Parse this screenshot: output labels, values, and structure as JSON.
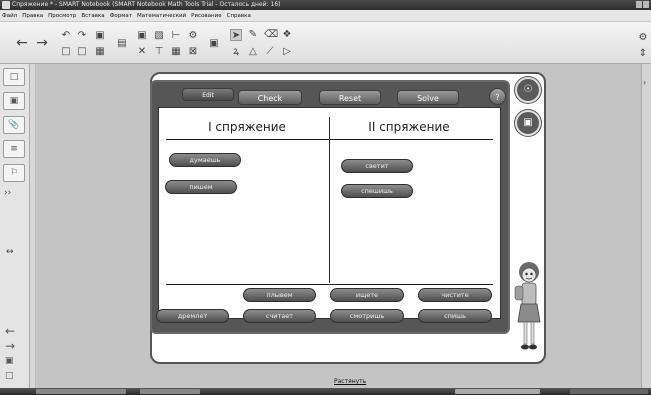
{
  "window": {
    "title": "Спряжение * - SMART Notebook (SMART Notebook Math Tools Trial - Осталось дней: 16)"
  },
  "menu": [
    "Файл",
    "Правка",
    "Просмотр",
    "Вставка",
    "Формат",
    "Математический",
    "Рисование",
    "Справка"
  ],
  "toolbar_icons": [
    "back-icon",
    "forward-icon",
    "undo-icon",
    "redo-icon",
    "paste-icon",
    "screen-shade-icon",
    "table-icon",
    "delete-icon",
    "select-icon",
    "pen-icon",
    "eraser-icon",
    "line-icon",
    "shape-icon",
    "fill-icon",
    "text-icon",
    "magic-pen-icon"
  ],
  "widget": {
    "buttons": {
      "edit": "Edit",
      "check": "Check",
      "reset": "Reset",
      "solve": "Solve",
      "help": "?"
    },
    "columns": [
      "I спряжение",
      "II спряжение"
    ],
    "column1_chips": [
      "думаешь",
      "пишем"
    ],
    "column2_chips": [
      "светит",
      "спешишь"
    ],
    "pool_row1": [
      "плывем",
      "ищете",
      "чистите"
    ],
    "pool_row2": [
      "дремлет",
      "считает",
      "смотришь",
      "спишь"
    ]
  },
  "page_link": "Растянуть",
  "colors": {
    "chrome": "#565656",
    "chip": "#6a6a6a",
    "background": "#c8c8c8"
  }
}
